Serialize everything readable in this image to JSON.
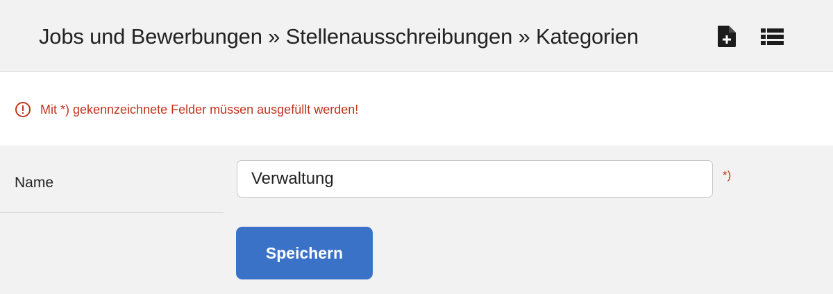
{
  "header": {
    "breadcrumb_title": "Jobs und Bewerbungen » Stellenausschreibungen » Kategorien",
    "icons": [
      "new-document-icon",
      "list-icon"
    ]
  },
  "notice": {
    "icon": "exclamation-circle-icon",
    "text": "Mit *) gekennzeichnete Felder müssen ausgefüllt werden!"
  },
  "form": {
    "name_label": "Name",
    "name_value": "Verwaltung",
    "required_marker": "*)",
    "save_label": "Speichern"
  },
  "colors": {
    "accent": "#3a72c8",
    "error": "#c0341d",
    "background": "#f2f2f2"
  }
}
